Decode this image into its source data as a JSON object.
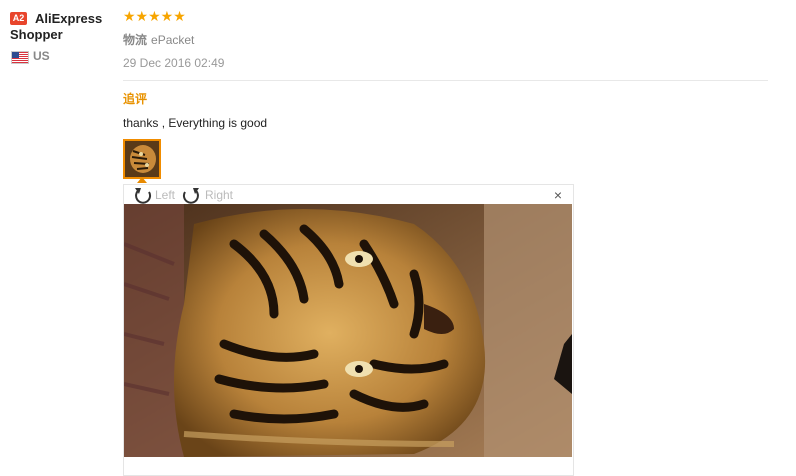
{
  "user": {
    "badge": "A2",
    "name": "AliExpress Shopper",
    "country": "US"
  },
  "review": {
    "stars": "★★★★★",
    "logistics_label": "物流",
    "logistics_value": "ePacket",
    "date": "29 Dec 2016 02:49",
    "additional_title": "追评",
    "comment": "thanks , Everything is good"
  },
  "viewer": {
    "rotate_left_label": "Left",
    "rotate_right_label": "Right",
    "close_symbol": "×"
  },
  "colors": {
    "star": "#f7a500",
    "accent_orange": "#e89200",
    "badge": "#e8452c"
  },
  "icons": [
    "us-flag-icon",
    "rotate-left-icon",
    "rotate-right-icon",
    "close-icon"
  ]
}
